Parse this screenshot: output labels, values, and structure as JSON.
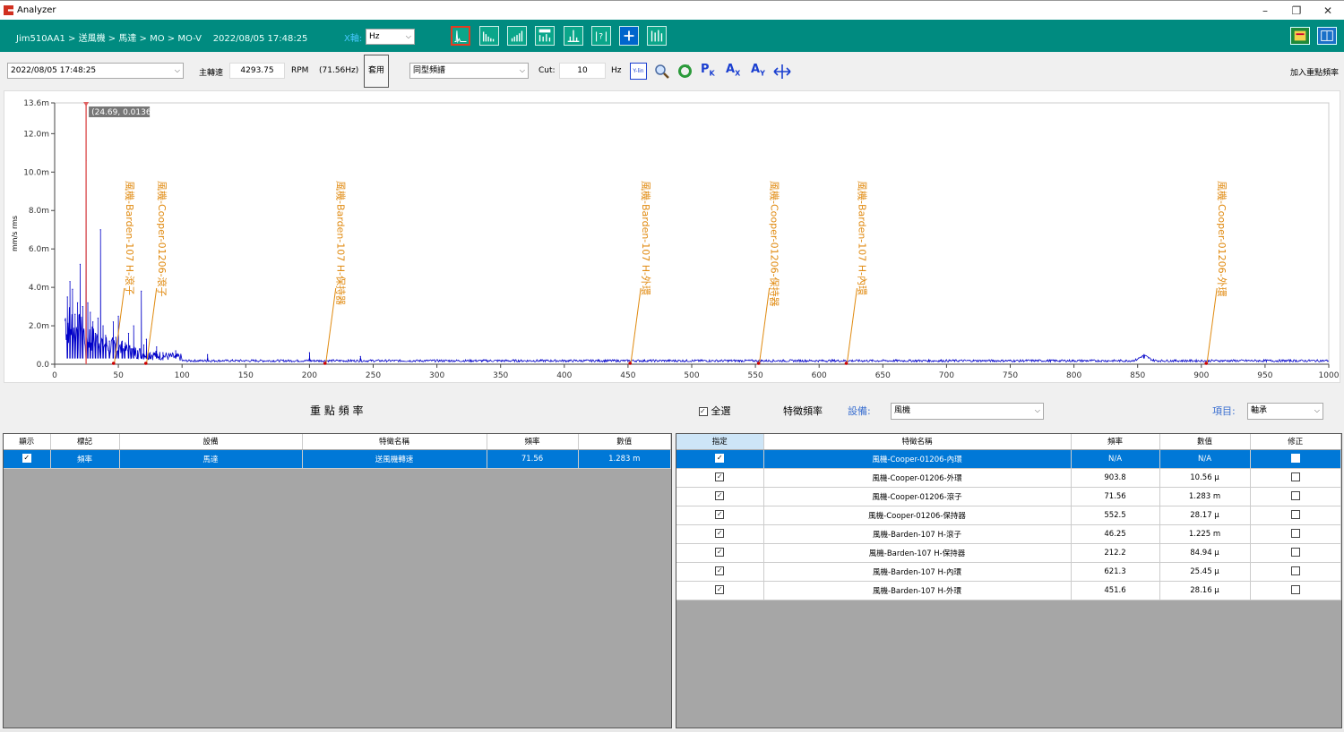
{
  "window": {
    "title": "Analyzer",
    "minimize": "–",
    "restore": "❐",
    "close": "✕"
  },
  "header": {
    "breadcrumb": "Jim510AA1 > 送風機 > 馬達 > MO > MO-V",
    "datetime": "2022/08/05 17:48:25",
    "xaxis_label": "X軸:",
    "xaxis_unit": "Hz",
    "toolbar_icons": [
      "spectrum-icon",
      "waterfall-icon",
      "trend-icon",
      "order-icon",
      "peak-icon",
      "help-icon",
      "add-icon",
      "cascade-icon"
    ]
  },
  "toolbar": {
    "date_select": "2022/08/05 17:48:25",
    "speed_label": "主轉速",
    "speed_value": "4293.75",
    "rpm_label": "RPM",
    "hz_value": "(71.56Hz)",
    "apply_label": "套用",
    "mode_select": "同型頻譜",
    "cut_label": "Cut:",
    "cut_value": "10",
    "cut_unit": "Hz",
    "ylin_label": "Y-lin",
    "pk_label": "P",
    "pk_sub": "K",
    "ax_label": "A",
    "ax_sub": "X",
    "ay_label": "A",
    "ay_sub": "Y",
    "add_key_freq": "加入重點頻率"
  },
  "chart_data": {
    "type": "line",
    "ylabel": "mm/s rms",
    "xlim": [
      0,
      1000
    ],
    "ylim": [
      0,
      13.6
    ],
    "x_ticks": [
      "0",
      "50",
      "100",
      "150",
      "200",
      "250",
      "300",
      "350",
      "400",
      "450",
      "500",
      "550",
      "600",
      "650",
      "700",
      "750",
      "800",
      "850",
      "900",
      "950",
      "1000"
    ],
    "y_ticks": [
      "0.0",
      "2.0m",
      "4.0m",
      "6.0m",
      "8.0m",
      "10.0m",
      "12.0m",
      "13.6m"
    ],
    "cursor": {
      "x": 24.69,
      "label": "(24.69, 0.0136)"
    },
    "color": "#0000c8",
    "peaks": [
      {
        "x": 10,
        "y": 3.5
      },
      {
        "x": 12,
        "y": 4.3
      },
      {
        "x": 14,
        "y": 3.9
      },
      {
        "x": 16,
        "y": 2.6
      },
      {
        "x": 18,
        "y": 3.2
      },
      {
        "x": 20,
        "y": 5.2
      },
      {
        "x": 22,
        "y": 3.0
      },
      {
        "x": 24.69,
        "y": 10.6
      },
      {
        "x": 26,
        "y": 3.2
      },
      {
        "x": 28,
        "y": 2.7
      },
      {
        "x": 30,
        "y": 2.2
      },
      {
        "x": 32,
        "y": 1.6
      },
      {
        "x": 34,
        "y": 2.4
      },
      {
        "x": 36,
        "y": 7.0
      },
      {
        "x": 38,
        "y": 2.0
      },
      {
        "x": 40,
        "y": 1.5
      },
      {
        "x": 43,
        "y": 1.2
      },
      {
        "x": 46,
        "y": 2.2
      },
      {
        "x": 48,
        "y": 1.4
      },
      {
        "x": 50,
        "y": 2.5
      },
      {
        "x": 53,
        "y": 1.2
      },
      {
        "x": 55,
        "y": 0.9
      },
      {
        "x": 58,
        "y": 1.6
      },
      {
        "x": 60,
        "y": 0.8
      },
      {
        "x": 62,
        "y": 2.0
      },
      {
        "x": 65,
        "y": 0.7
      },
      {
        "x": 68,
        "y": 3.8
      },
      {
        "x": 70,
        "y": 1.0
      },
      {
        "x": 72,
        "y": 1.3
      },
      {
        "x": 75,
        "y": 0.6
      },
      {
        "x": 80,
        "y": 0.9
      },
      {
        "x": 85,
        "y": 0.6
      },
      {
        "x": 95,
        "y": 0.7
      },
      {
        "x": 120,
        "y": 0.5
      },
      {
        "x": 200,
        "y": 0.6
      },
      {
        "x": 240,
        "y": 0.4
      },
      {
        "x": 855,
        "y": 0.5
      }
    ],
    "annotations": [
      {
        "x": 46.25,
        "text": "風機-Barden-107 H-滾子"
      },
      {
        "x": 71.56,
        "text": "風機-Cooper-01206-滾子"
      },
      {
        "x": 212.2,
        "text": "風機-Barden-107 H-保持器"
      },
      {
        "x": 451.6,
        "text": "風機-Barden-107 H-外環"
      },
      {
        "x": 552.5,
        "text": "風機-Cooper-01206-保持器"
      },
      {
        "x": 621.3,
        "text": "風機-Barden-107 H-內環"
      },
      {
        "x": 903.8,
        "text": "風機-Cooper-01206-外環"
      }
    ],
    "annotation_color": "#e08a10"
  },
  "key_freq": {
    "title": "重 點 頻 率",
    "columns": [
      "顯示",
      "標記",
      "設備",
      "特徵名稱",
      "頻率",
      "數值"
    ],
    "rows": [
      {
        "mark": "頻率",
        "device": "馬達",
        "name": "送風機轉速",
        "freq": "71.56",
        "value": "1.283 m"
      }
    ]
  },
  "feature_freq": {
    "select_all": "全選",
    "title": "特徵頻率",
    "device_label": "設備:",
    "device_value": "風機",
    "item_label": "項目:",
    "item_value": "軸承",
    "columns": [
      "指定",
      "特徵名稱",
      "頻率",
      "數值",
      "修正"
    ],
    "rows": [
      {
        "name": "風機-Cooper-01206-內環",
        "freq": "N/A",
        "value": "N/A"
      },
      {
        "name": "風機-Cooper-01206-外環",
        "freq": "903.8",
        "value": "10.56 μ"
      },
      {
        "name": "風機-Cooper-01206-滾子",
        "freq": "71.56",
        "value": "1.283 m"
      },
      {
        "name": "風機-Cooper-01206-保持器",
        "freq": "552.5",
        "value": "28.17 μ"
      },
      {
        "name": "風機-Barden-107 H-滾子",
        "freq": "46.25",
        "value": "1.225 m"
      },
      {
        "name": "風機-Barden-107 H-保持器",
        "freq": "212.2",
        "value": "84.94 μ"
      },
      {
        "name": "風機-Barden-107 H-內環",
        "freq": "621.3",
        "value": "25.45 μ"
      },
      {
        "name": "風機-Barden-107 H-外環",
        "freq": "451.6",
        "value": "28.16 μ"
      }
    ]
  }
}
